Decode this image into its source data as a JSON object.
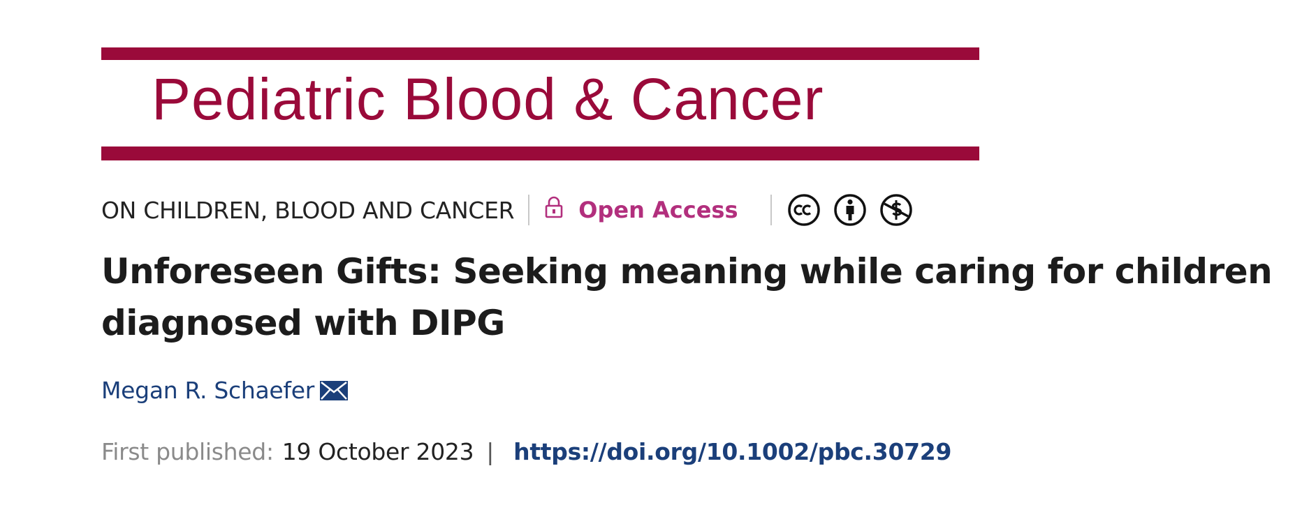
{
  "journal": {
    "name": "Pediatric Blood & Cancer",
    "brand_color": "#9a0a3a"
  },
  "meta": {
    "section": "ON CHILDREN, BLOOD AND CANCER",
    "open_access_label": "Open Access",
    "open_access_color": "#b22f7d",
    "license_icons": [
      "creative-commons-icon",
      "attribution-icon",
      "non-commercial-icon"
    ]
  },
  "article": {
    "title": "Unforeseen Gifts: Seeking meaning while caring for children diagnosed with DIPG"
  },
  "author": {
    "name": "Megan R. Schaefer",
    "contact_icon": "mail-icon"
  },
  "publication": {
    "label": "First published:",
    "date": "19 October 2023",
    "separator": "|",
    "doi": "https://doi.org/10.1002/pbc.30729",
    "link_color": "#1b3f7a"
  }
}
